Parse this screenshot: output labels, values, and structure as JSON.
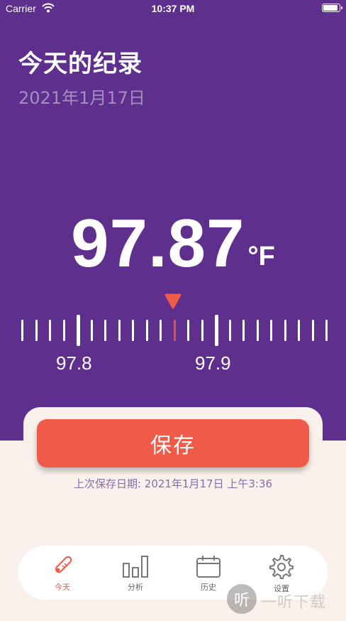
{
  "status_bar": {
    "carrier": "Carrier",
    "time": "10:37 PM"
  },
  "header": {
    "title": "今天的纪录",
    "date": "2021年1月17日"
  },
  "reading": {
    "value": "97.87",
    "unit": "°F"
  },
  "scale": {
    "labels": [
      "97.8",
      "97.9"
    ],
    "current": 97.87
  },
  "actions": {
    "save_label": "保存",
    "last_saved": "上次保存日期: 2021年1月17日 上午3:36"
  },
  "tabs": [
    {
      "label": "今天",
      "icon": "thermometer-icon",
      "active": true
    },
    {
      "label": "分析",
      "icon": "bar-chart-icon",
      "active": false
    },
    {
      "label": "历史",
      "icon": "calendar-icon",
      "active": false
    },
    {
      "label": "设置",
      "icon": "gear-icon",
      "active": false
    }
  ],
  "watermark": {
    "glyph": "听",
    "text": "一听下载"
  },
  "colors": {
    "primary": "#5e2f8d",
    "accent": "#f05a49",
    "background": "#fbf1ec"
  }
}
